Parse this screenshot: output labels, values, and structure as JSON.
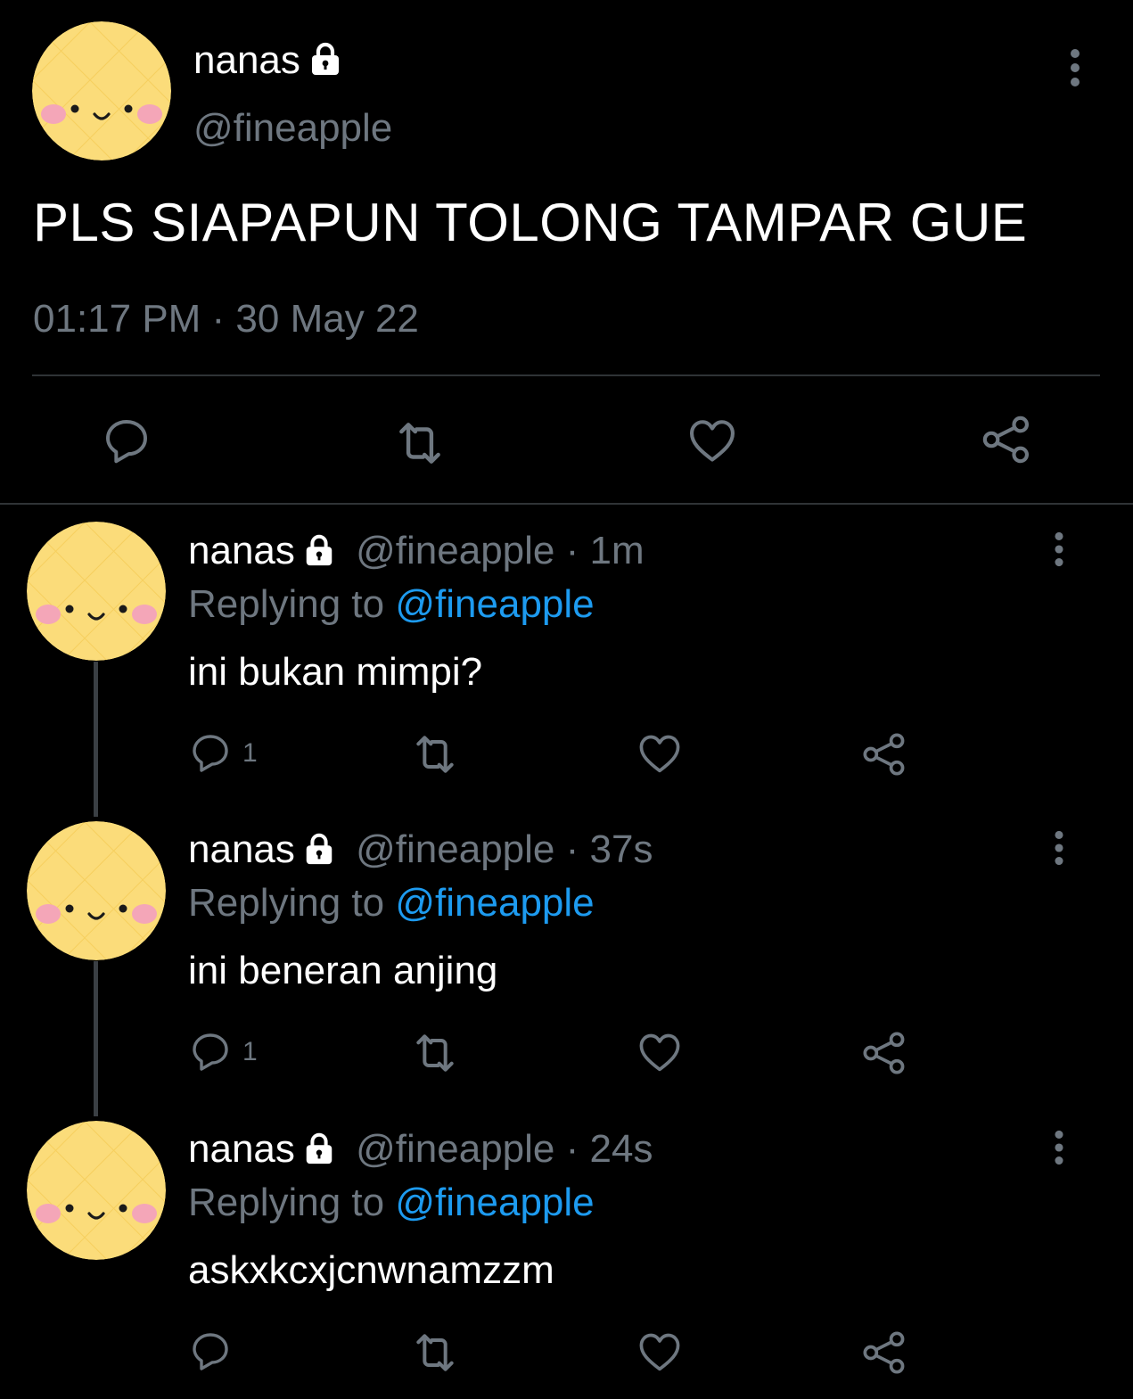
{
  "main_tweet": {
    "display_name": "nanas",
    "handle": "@fineapple",
    "text": "PLS SIAPAPUN TOLONG TAMPAR GUE",
    "timestamp": "01:17 PM · 30 May 22",
    "icons": [
      "reply-icon",
      "retweet-icon",
      "like-icon",
      "share-icon",
      "more-icon",
      "lock-icon"
    ]
  },
  "replies": [
    {
      "display_name": "nanas",
      "handle": "@fineapple",
      "time": "· 1m",
      "replying_label": "Replying to",
      "replying_handle": "@fineapple",
      "text": "ini bukan mimpi?",
      "reply_count": "1"
    },
    {
      "display_name": "nanas",
      "handle": "@fineapple",
      "time": "· 37s",
      "replying_label": "Replying to",
      "replying_handle": "@fineapple",
      "text": "ini beneran anjing",
      "reply_count": "1"
    },
    {
      "display_name": "nanas",
      "handle": "@fineapple",
      "time": "· 24s",
      "replying_label": "Replying to",
      "replying_handle": "@fineapple",
      "text": "askxkcxjcnwnamzzm",
      "reply_count": ""
    }
  ],
  "colors": {
    "background": "#000000",
    "text": "#ffffff",
    "muted": "#6e7780",
    "link": "#1d9bf0",
    "avatar": "#fbdc7a",
    "cheek": "#f4a6b8"
  }
}
